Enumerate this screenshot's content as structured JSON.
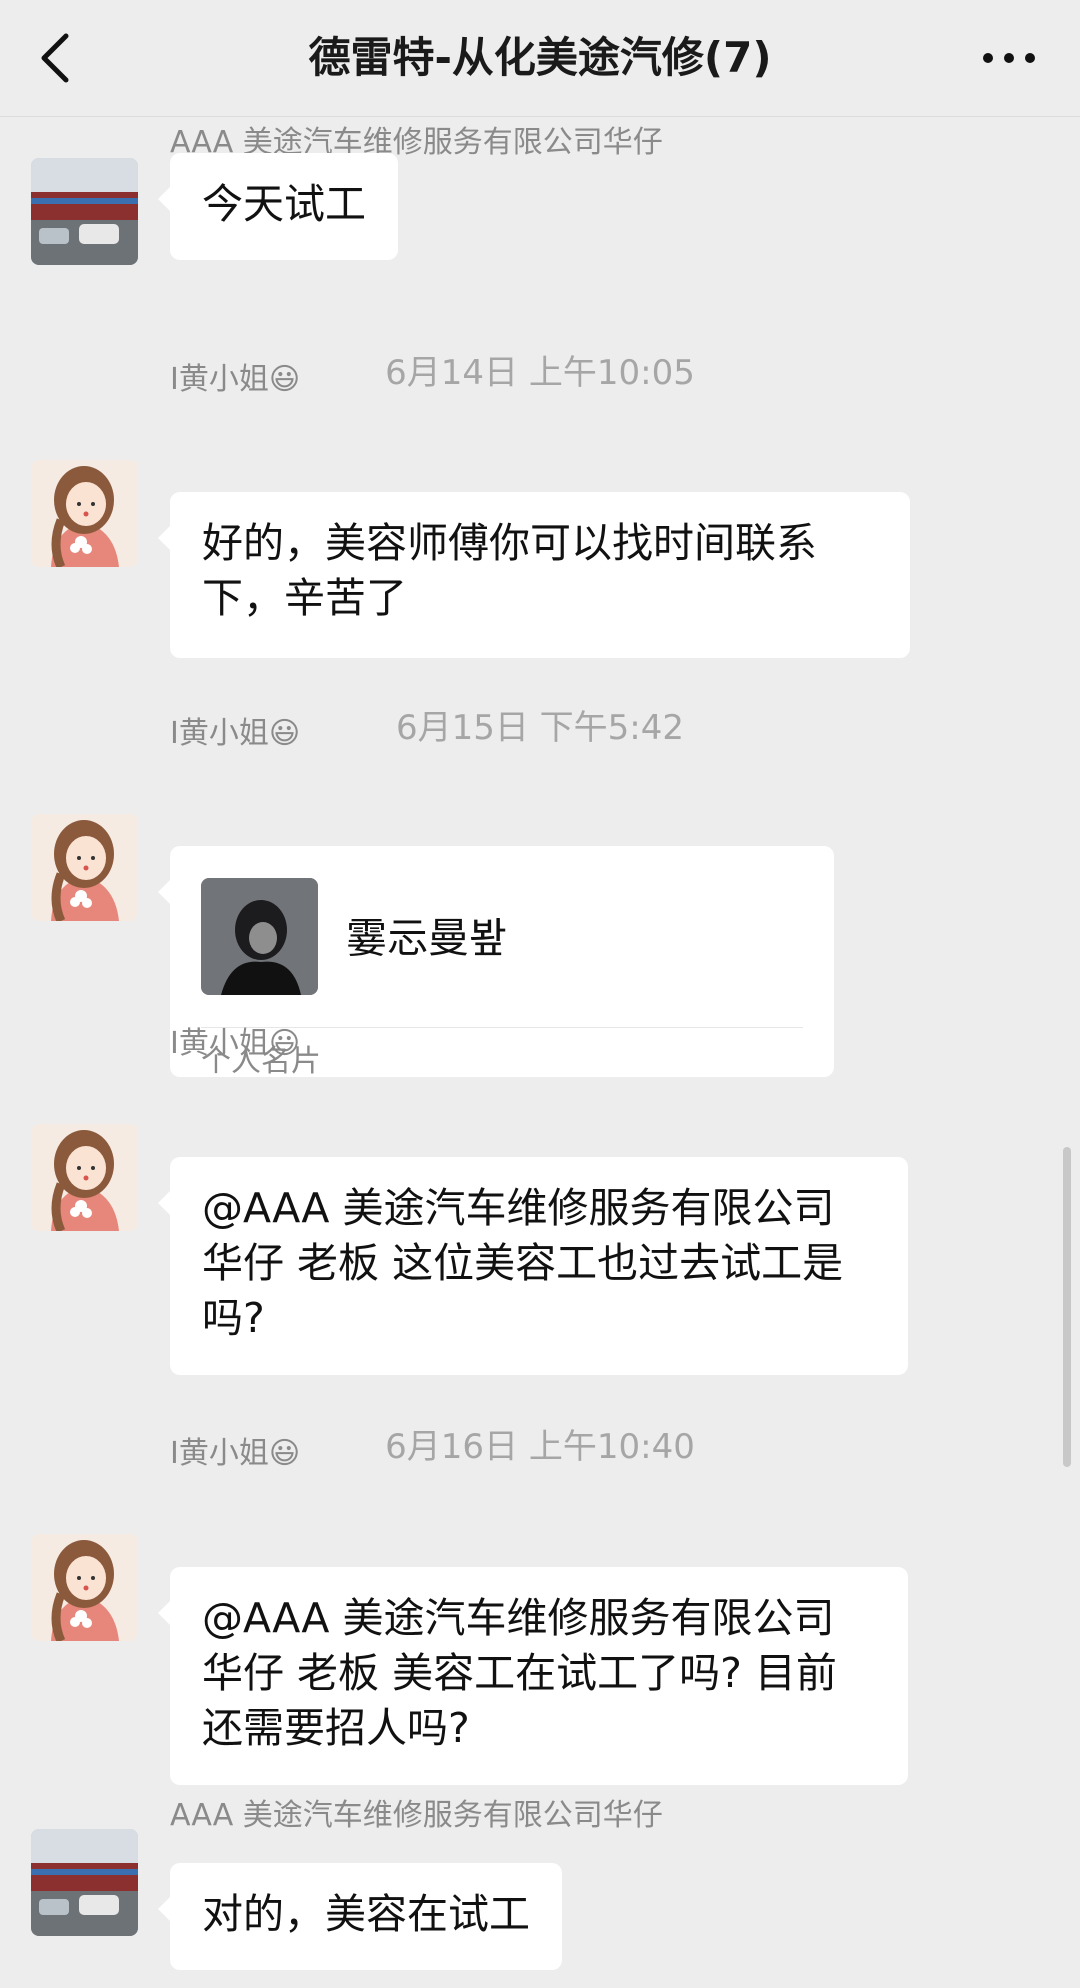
{
  "header": {
    "title": "德雷特-从化美途汽修(7)",
    "back_icon": "chevron-left-icon",
    "more_icon": "more-horizontal-icon"
  },
  "messages": [
    {
      "sender": "AAA 美途汽车维修服务有限公司华仔",
      "text": "今天试工"
    },
    {
      "timestamp": "6月14日 上午10:05"
    },
    {
      "sender": "I黄小姐😃",
      "text": "好的，美容师傅你可以找时间联系下，辛苦了"
    },
    {
      "timestamp": "6月15日 下午5:42"
    },
    {
      "sender": "I黄小姐😃",
      "card_name": "霎忈曼봪",
      "card_label": "个人名片"
    },
    {
      "sender": "I黄小姐😃",
      "text": "@AAA 美途汽车维修服务有限公司 华仔 老板 这位美容工也过去试工是吗?"
    },
    {
      "timestamp": "6月16日 上午10:40"
    },
    {
      "sender": "I黄小姐😃",
      "text": "@AAA 美途汽车维修服务有限公司 华仔 老板 美容工在试工了吗? 目前还需要招人吗?"
    },
    {
      "sender": "AAA 美途汽车维修服务有限公司华仔",
      "text": "对的，美容在试工"
    }
  ]
}
